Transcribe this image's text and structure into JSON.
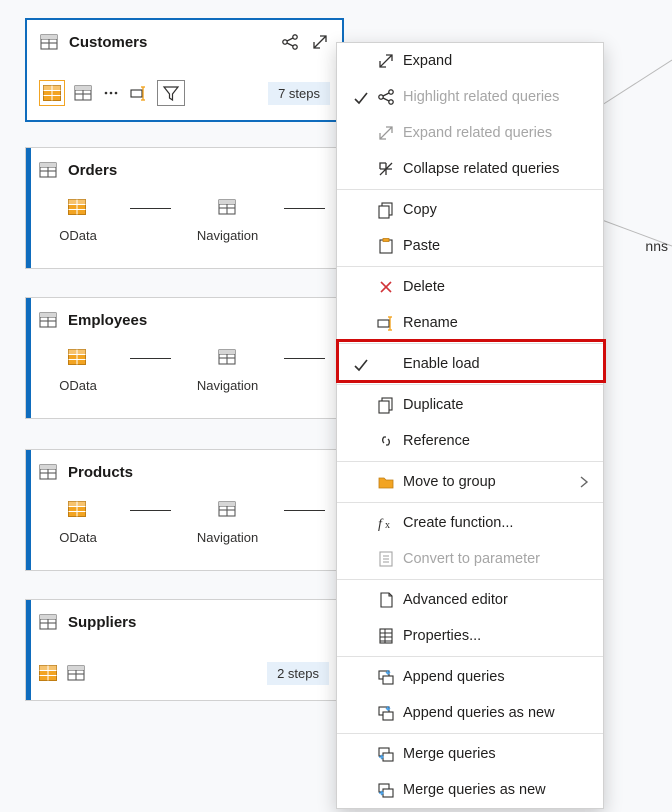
{
  "cards": {
    "customers": {
      "title": "Customers",
      "steps_badge": "7 steps"
    },
    "orders": {
      "title": "Orders",
      "step1": "OData",
      "step2": "Navigation"
    },
    "employees": {
      "title": "Employees",
      "step1": "OData",
      "step2": "Navigation"
    },
    "products": {
      "title": "Products",
      "step1": "OData",
      "step2": "Navigation"
    },
    "suppliers": {
      "title": "Suppliers",
      "steps_badge": "2 steps"
    }
  },
  "context_menu": {
    "expand": "Expand",
    "highlight_related": "Highlight related queries",
    "expand_related": "Expand related queries",
    "collapse_related": "Collapse related queries",
    "copy": "Copy",
    "paste": "Paste",
    "delete": "Delete",
    "rename": "Rename",
    "enable_load": "Enable load",
    "duplicate": "Duplicate",
    "reference": "Reference",
    "move_to_group": "Move to group",
    "create_function": "Create function...",
    "convert_to_parameter": "Convert to parameter",
    "advanced_editor": "Advanced editor",
    "properties": "Properties...",
    "append_queries": "Append queries",
    "append_queries_new": "Append queries as new",
    "merge_queries": "Merge queries",
    "merge_queries_new": "Merge queries as new"
  },
  "off_right_label": "nns"
}
